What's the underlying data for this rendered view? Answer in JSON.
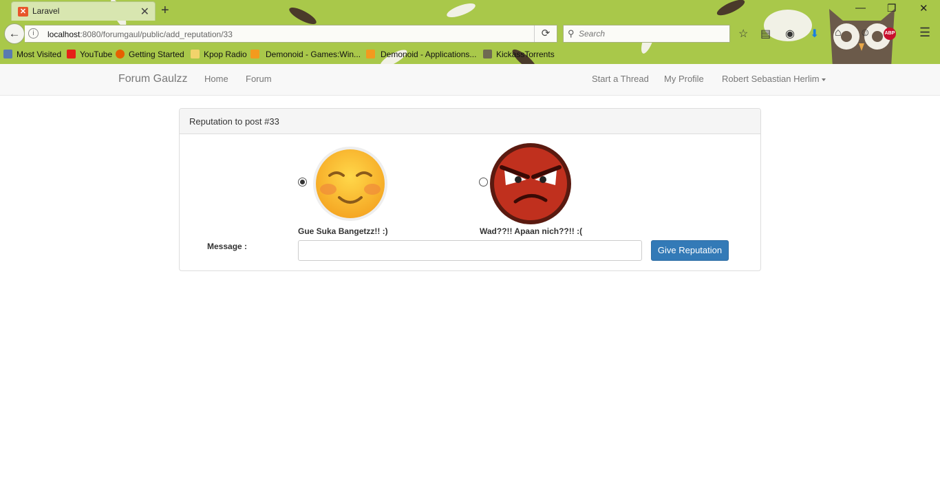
{
  "browser": {
    "tab_title": "Laravel",
    "url_host": "localhost",
    "url_rest": ":8080/forumgaul/public/add_reputation/33",
    "search_placeholder": "Search",
    "bookmarks": [
      {
        "label": "Most Visited",
        "icon": "bookmark-folder-icon"
      },
      {
        "label": "YouTube",
        "icon": "youtube-icon"
      },
      {
        "label": "Getting Started",
        "icon": "firefox-icon"
      },
      {
        "label": "Kpop Radio",
        "icon": "folder-icon"
      },
      {
        "label": "Demonoid - Games:Win...",
        "icon": "rss-icon"
      },
      {
        "label": "Demonoid - Applications...",
        "icon": "rss-icon"
      },
      {
        "label": "KickassTorrents",
        "icon": "shield-icon"
      }
    ]
  },
  "navbar": {
    "brand": "Forum Gaulzz",
    "home": "Home",
    "forum": "Forum",
    "start_thread": "Start a Thread",
    "my_profile": "My Profile",
    "user_name": "Robert Sebastian Herlim"
  },
  "panel": {
    "heading": "Reputation to post #33",
    "option_good": "Gue Suka Bangetzz!! :)",
    "option_bad": "Wad??!! Apaan nich??!! :(",
    "message_label": "Message :",
    "message_value": "",
    "submit_label": "Give Reputation"
  },
  "colors": {
    "chrome_green": "#a9c84a",
    "button_blue": "#337ab7"
  }
}
